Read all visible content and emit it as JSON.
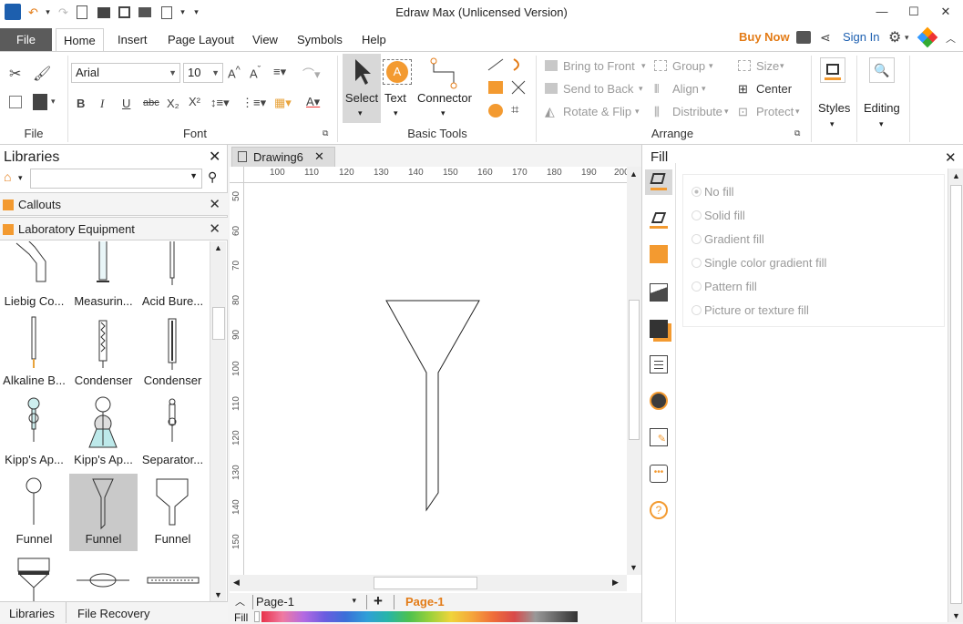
{
  "window": {
    "title": "Edraw Max (Unlicensed Version)",
    "minimize": "—",
    "maximize": "☐",
    "close": "✕"
  },
  "menu_tabs": {
    "file": "File",
    "home": "Home",
    "insert": "Insert",
    "page_layout": "Page Layout",
    "view": "View",
    "symbols": "Symbols",
    "help": "Help"
  },
  "account": {
    "buy_now": "Buy Now",
    "sign_in": "Sign In"
  },
  "ribbon": {
    "groups": {
      "file": "File",
      "font": "Font",
      "basic_tools": "Basic Tools",
      "arrange": "Arrange"
    },
    "font_name": "Arial",
    "font_size": "10",
    "basic_tools": {
      "select": "Select",
      "text": "Text",
      "connector": "Connector"
    },
    "arrange": {
      "bring_to_front": "Bring to Front",
      "send_to_back": "Send to Back",
      "rotate_flip": "Rotate & Flip",
      "group": "Group",
      "align": "Align",
      "distribute": "Distribute",
      "size": "Size",
      "center": "Center",
      "protect": "Protect"
    },
    "styles": "Styles",
    "editing": "Editing"
  },
  "libraries": {
    "title": "Libraries",
    "search_placeholder": "",
    "sections": [
      "Callouts",
      "Laboratory Equipment"
    ],
    "symbols": [
      [
        "Liebig Co...",
        "Measurin...",
        "Acid Bure..."
      ],
      [
        "Alkaline B...",
        "Condenser",
        "Condenser"
      ],
      [
        "Kipp's Ap...",
        "Kipp's Ap...",
        "Separator..."
      ],
      [
        "Funnel",
        "Funnel",
        "Funnel"
      ]
    ],
    "bottom_tabs": [
      "Libraries",
      "File Recovery"
    ]
  },
  "document": {
    "tab": "Drawing6",
    "ruler_h": [
      "100",
      "110",
      "120",
      "130",
      "140",
      "150",
      "160",
      "170",
      "180",
      "190",
      "200"
    ],
    "ruler_v": [
      "50",
      "60",
      "70",
      "80",
      "90",
      "100",
      "110",
      "120",
      "130",
      "140",
      "150"
    ],
    "page_select": "Page-1",
    "page_tab": "Page-1",
    "fill_label": "Fill"
  },
  "fill_panel": {
    "title": "Fill",
    "options": [
      "No fill",
      "Solid fill",
      "Gradient fill",
      "Single color gradient fill",
      "Pattern fill",
      "Picture or texture fill"
    ],
    "selected": "No fill"
  },
  "colors": {
    "accent": "#e37b16",
    "file_tab": "#5b5b5b",
    "orange_icon": "#f39a30"
  }
}
